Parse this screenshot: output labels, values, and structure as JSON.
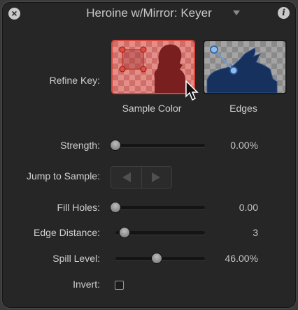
{
  "window": {
    "title": "Heroine w/Mirror: Keyer",
    "close_icon": "close-icon",
    "info_icon": "info-icon"
  },
  "refine_key": {
    "label": "Refine Key:",
    "sample_color": {
      "caption": "Sample Color",
      "selected": true,
      "accent": "#d9463b"
    },
    "edges": {
      "caption": "Edges",
      "selected": false
    }
  },
  "controls": {
    "strength": {
      "label": "Strength:",
      "value": "0.00%",
      "fraction": 0.0
    },
    "jump_to_sample": {
      "label": "Jump to Sample:",
      "prev_icon": "triangle-left-icon",
      "next_icon": "triangle-right-icon"
    },
    "fill_holes": {
      "label": "Fill Holes:",
      "value": "0.00",
      "fraction": 0.0
    },
    "edge_distance": {
      "label": "Edge Distance:",
      "value": "3",
      "fraction": 0.1
    },
    "spill_level": {
      "label": "Spill Level:",
      "value": "46.00%",
      "fraction": 0.46
    },
    "invert": {
      "label": "Invert:",
      "checked": false
    }
  },
  "colors": {
    "panel_bg": "#262626",
    "text": "#cfcfcf",
    "selection_red": "#d9463b"
  }
}
